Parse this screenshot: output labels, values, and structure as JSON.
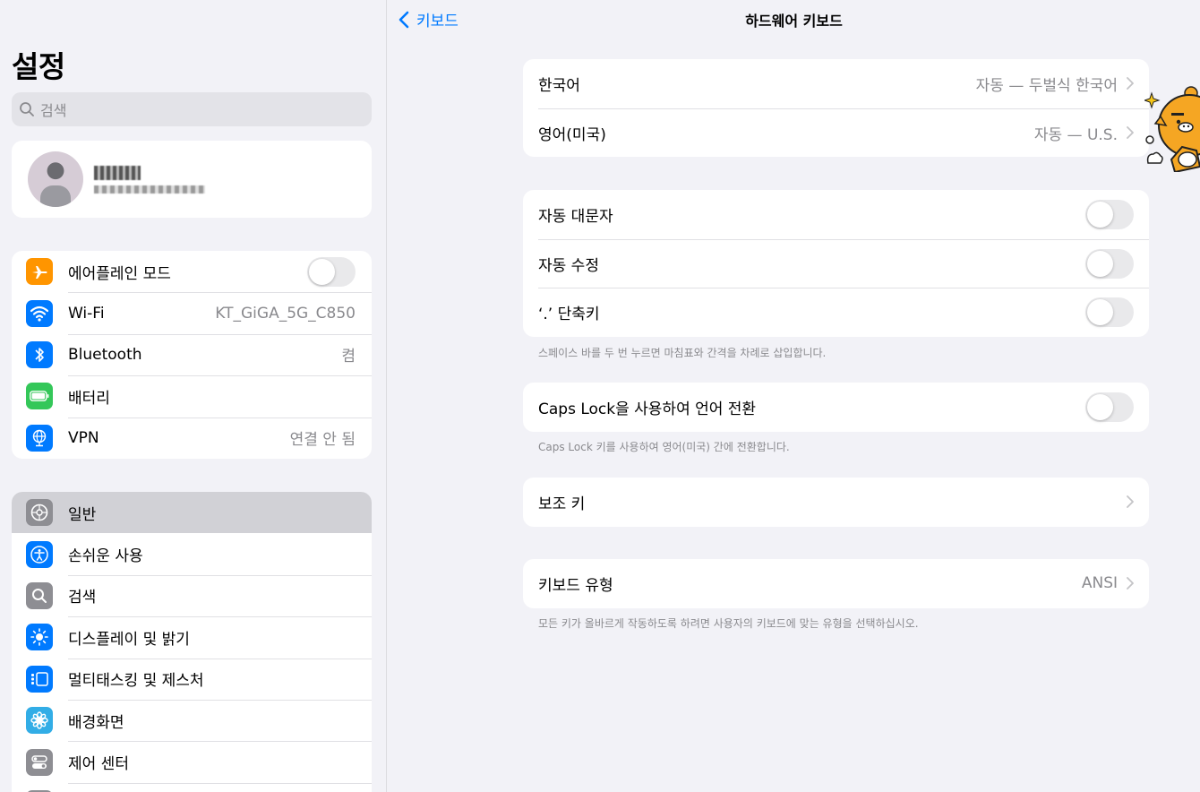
{
  "sidebar": {
    "title": "설정",
    "search_placeholder": "검색",
    "group1": [
      {
        "label": "에어플레인 모드",
        "icon": "airplane-icon",
        "color": "#ff9500",
        "toggle": false
      },
      {
        "label": "Wi-Fi",
        "value": "KT_GiGA_5G_C850",
        "icon": "wifi-icon",
        "color": "#007aff"
      },
      {
        "label": "Bluetooth",
        "value": "켬",
        "icon": "bluetooth-icon",
        "color": "#007aff"
      },
      {
        "label": "배터리",
        "icon": "battery-icon",
        "color": "#34c759"
      },
      {
        "label": "VPN",
        "value": "연결 안 됨",
        "icon": "vpn-globe-icon",
        "color": "#007aff"
      }
    ],
    "group2": [
      {
        "label": "일반",
        "icon": "gear-icon",
        "color": "#8e8e93",
        "selected": true
      },
      {
        "label": "손쉬운 사용",
        "icon": "accessibility-icon",
        "color": "#007aff"
      },
      {
        "label": "검색",
        "icon": "search-icon",
        "color": "#8e8e93"
      },
      {
        "label": "디스플레이 및 밝기",
        "icon": "brightness-icon",
        "color": "#007aff"
      },
      {
        "label": "멀티태스킹 및 제스처",
        "icon": "multitasking-icon",
        "color": "#007aff"
      },
      {
        "label": "배경화면",
        "icon": "wallpaper-flower-icon",
        "color": "#32ade6"
      },
      {
        "label": "제어 센터",
        "icon": "control-center-icon",
        "color": "#8e8e93"
      }
    ]
  },
  "nav": {
    "back_label": "키보드",
    "title": "하드웨어 키보드"
  },
  "main": {
    "languages": [
      {
        "label": "한국어",
        "value": "자동 — 두벌식 한국어"
      },
      {
        "label": "영어(미국)",
        "value": "자동 — U.S."
      }
    ],
    "options": [
      {
        "label": "자동 대문자",
        "toggle": false
      },
      {
        "label": "자동 수정",
        "toggle": false
      },
      {
        "label": "‘.’ 단축키",
        "toggle": false
      }
    ],
    "options_note": "스페이스 바를 두 번 누르면 마침표와 간격을 차례로 삽입합니다.",
    "caps_lock": {
      "label": "Caps Lock을 사용하여 언어 전환",
      "toggle": false
    },
    "caps_lock_note": "Caps Lock 키를 사용하여 영어(미국) 간에 전환합니다.",
    "modifier_keys": {
      "label": "보조 키"
    },
    "keyboard_type": {
      "label": "키보드 유형",
      "value": "ANSI"
    },
    "keyboard_type_note": "모든 키가 올바르게 작동하도록 하려면 사용자의 키보드에 맞는 유형을 선택하십시오."
  },
  "colors": {
    "accent": "#007aff",
    "background": "#f2f2f7",
    "selected_row": "#d1d1d6"
  }
}
